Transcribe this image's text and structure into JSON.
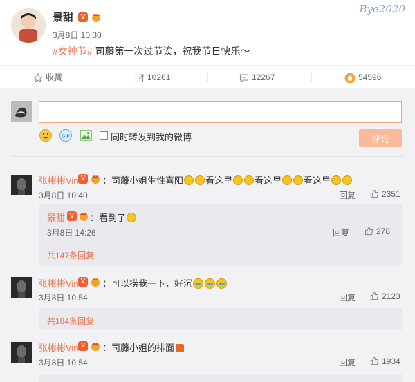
{
  "post": {
    "author": "景甜",
    "time": "3月8日 10:30",
    "topic": "#女神节#",
    "text": " 司藤第一次过节诶，祝我节日快乐～",
    "watermark": "Bye2020"
  },
  "actions": {
    "favorite": "收藏",
    "repost": "10261",
    "comments": "12267",
    "likes": "54596"
  },
  "composer": {
    "placeholder": "",
    "forward_label": "同时转发到我的微博",
    "submit": "评论"
  },
  "comments": [
    {
      "user": "张彬彬Vin",
      "text_parts": [
        "：司藤小姐生性喜阳",
        "看这里",
        "看这里",
        "看这里"
      ],
      "time": "3月8日 10:40",
      "reply": "回复",
      "likes": "2351",
      "sub": {
        "user": "景甜",
        "text": "：看到了",
        "time": "3月8日 14:26",
        "reply": "回复",
        "likes": "278"
      },
      "more": "共147条回复"
    },
    {
      "user": "张彬彬Vin",
      "text": "：可以捞我一下，好沉",
      "time": "3月8日 10:54",
      "reply": "回复",
      "likes": "2123",
      "more": "共184条回复"
    },
    {
      "user": "张彬彬Vin",
      "text": "：司藤小姐的排面",
      "time": "3月8日 10:54",
      "reply": "回复",
      "likes": "1934"
    }
  ],
  "colors": {
    "accent": "#eb7350",
    "submit": "#f8b99c",
    "input_border": "#f5a67e",
    "background": "#f2f2f5"
  }
}
